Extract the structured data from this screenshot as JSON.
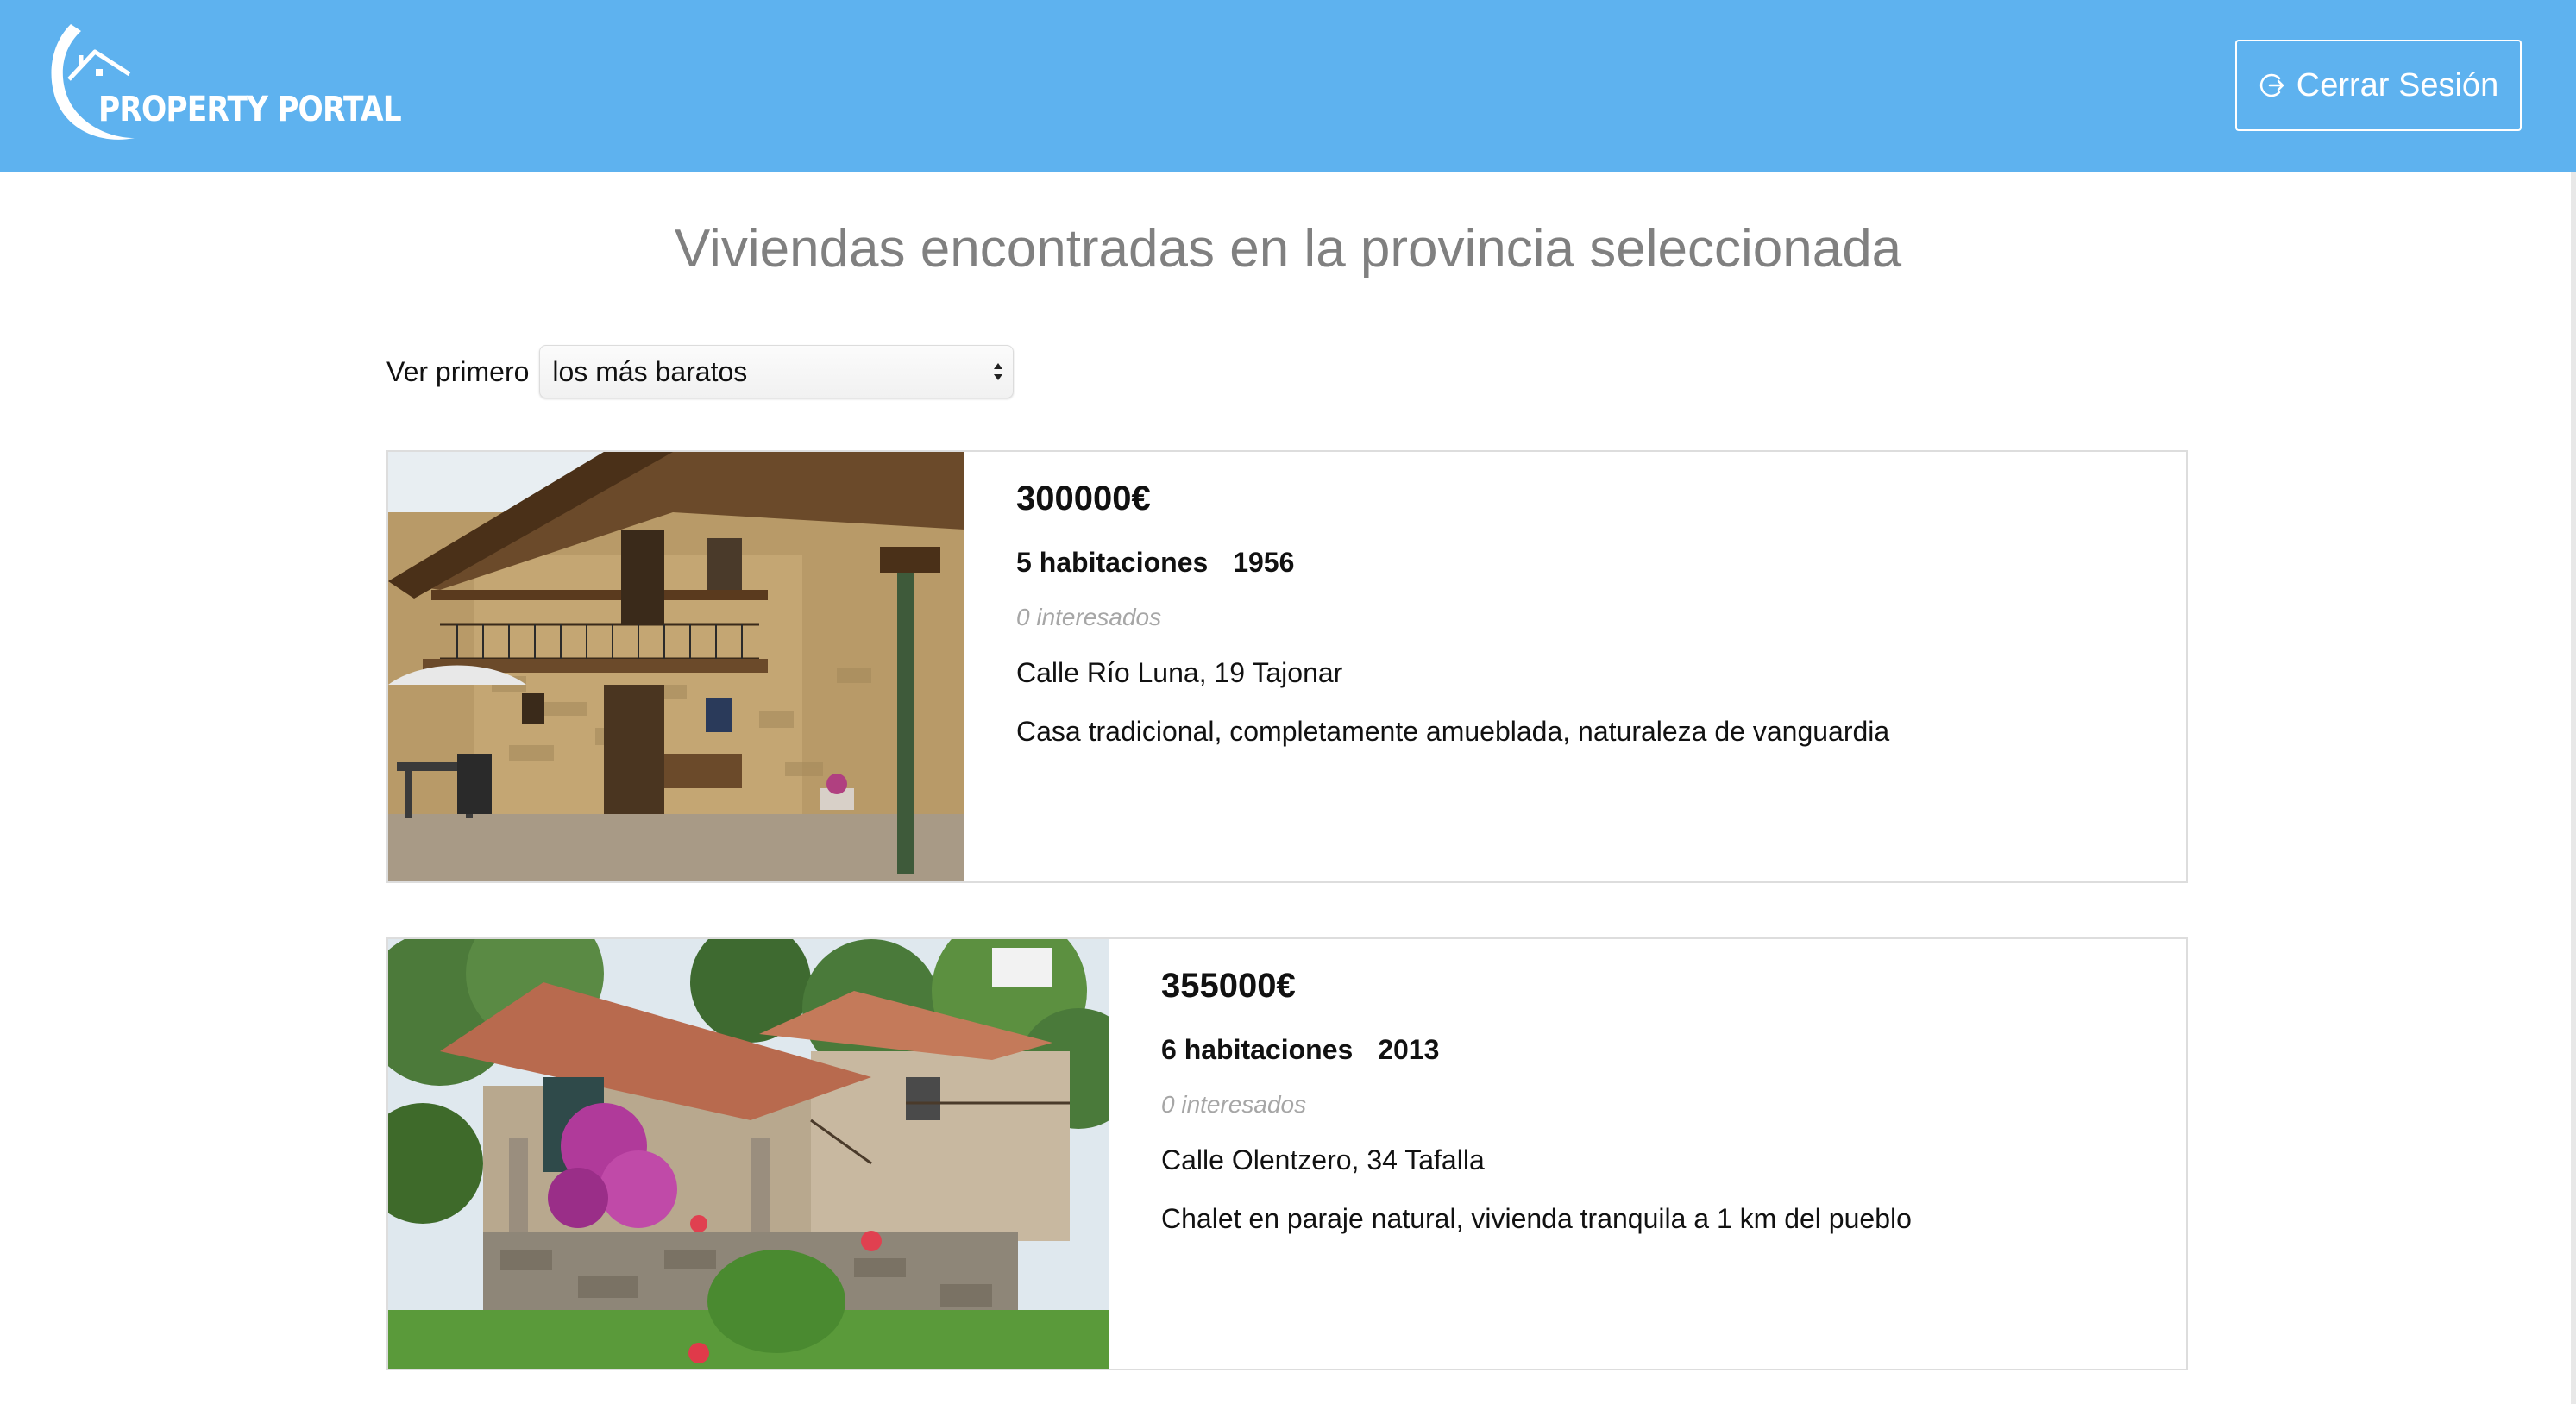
{
  "header": {
    "logo_text": "PROPERTY PORTAL",
    "logout_label": "Cerrar Sesión",
    "background_color": "#5eb2ef"
  },
  "page": {
    "title": "Viviendas encontradas en la provincia seleccionada"
  },
  "sort": {
    "label": "Ver primero",
    "selected": "los más baratos"
  },
  "listings": [
    {
      "price": "300000€",
      "rooms": "5 habitaciones",
      "year": "1956",
      "interested": "0 interesados",
      "address": "Calle Río Luna, 19 Tajonar",
      "description": "Casa tradicional, completamente amueblada, naturaleza de vanguardia",
      "image": "stone-house-with-balcony-photo"
    },
    {
      "price": "355000€",
      "rooms": "6 habitaciones",
      "year": "2013",
      "interested": "0 interesados",
      "address": "Calle Olentzero, 34 Tafalla",
      "description": "Chalet en paraje natural, vivienda tranquila a 1 km del pueblo",
      "image": "stone-chalet-with-garden-photo"
    }
  ]
}
